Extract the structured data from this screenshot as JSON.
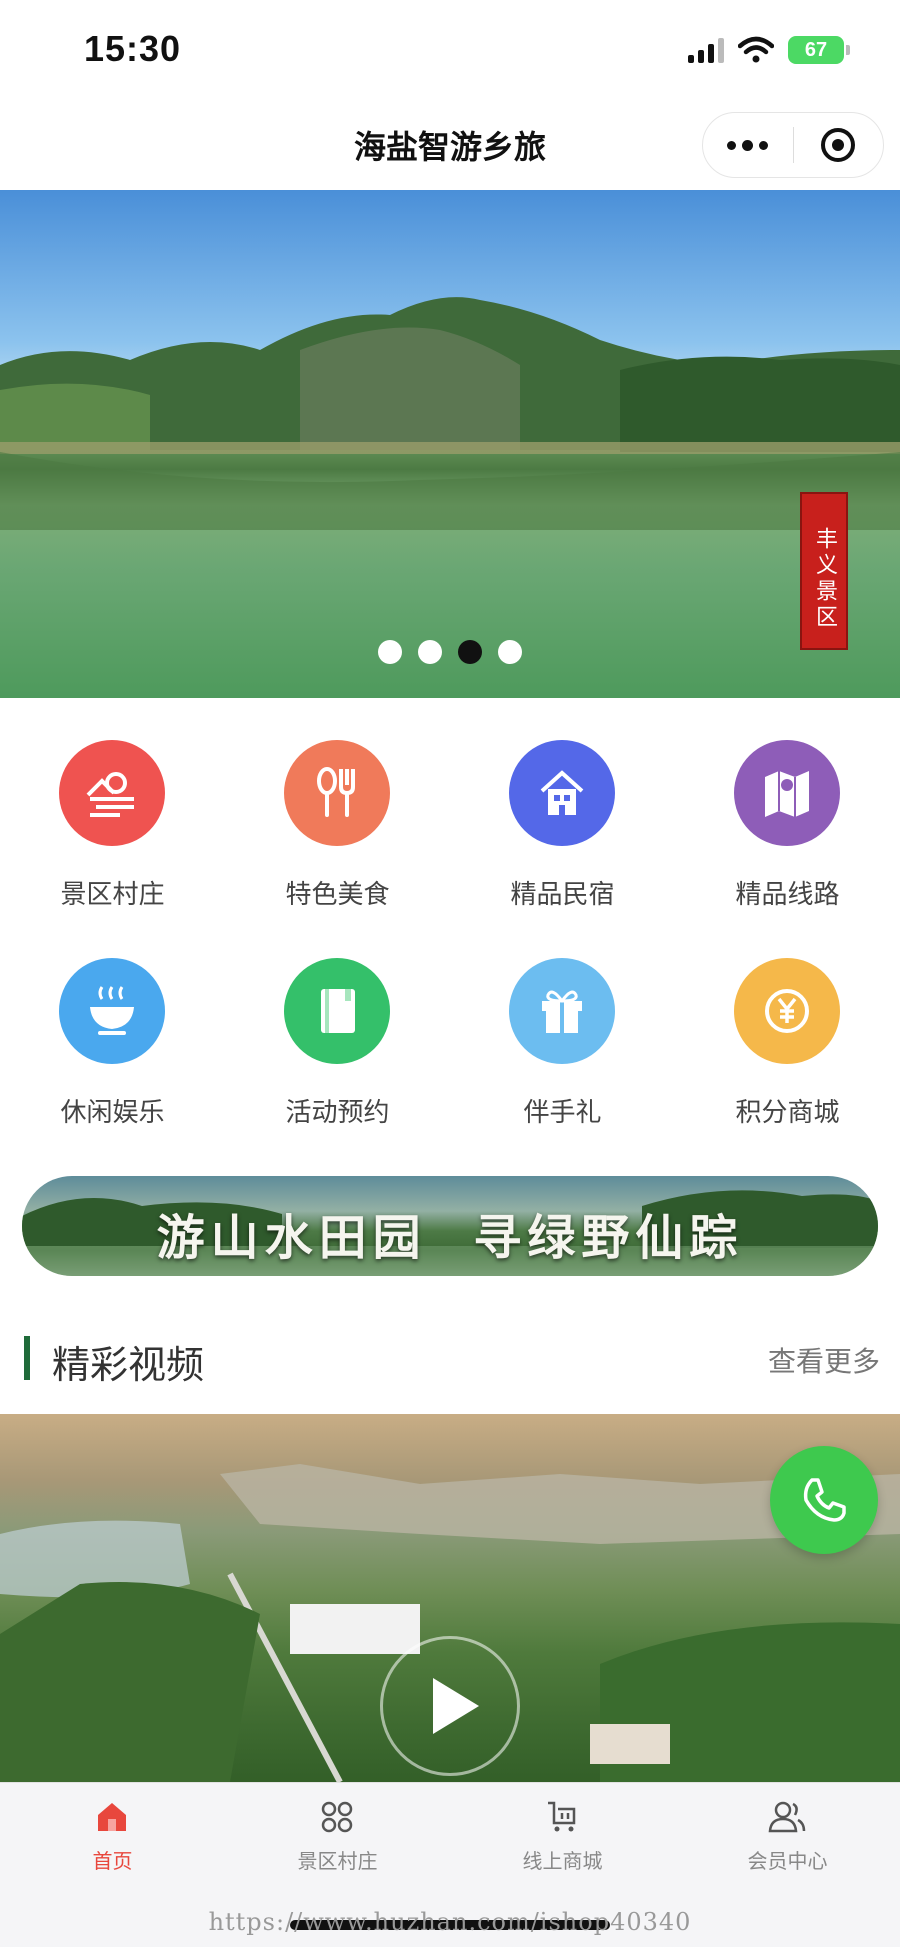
{
  "status": {
    "time": "15:30",
    "battery": "67"
  },
  "nav": {
    "title": "海盐智游乡旅"
  },
  "banner": {
    "seal_text": "丰义景区",
    "slide_count": 4,
    "active_slide": 3
  },
  "categories": [
    {
      "label": "景区村庄",
      "icon": "landscape-icon",
      "color": "#ef5350"
    },
    {
      "label": "特色美食",
      "icon": "utensils-icon",
      "color": "#f07a5a"
    },
    {
      "label": "精品民宿",
      "icon": "homestay-icon",
      "color": "#5468e8"
    },
    {
      "label": "精品线路",
      "icon": "map-icon",
      "color": "#8e5db8"
    },
    {
      "label": "休闲娱乐",
      "icon": "tea-cup-icon",
      "color": "#4aa8ee"
    },
    {
      "label": "活动预约",
      "icon": "book-icon",
      "color": "#34c06a"
    },
    {
      "label": "伴手礼",
      "icon": "gift-icon",
      "color": "#6cbdf0"
    },
    {
      "label": "积分商城",
      "icon": "coin-icon",
      "color": "#f5b84a"
    }
  ],
  "slogan": {
    "text": "游山水田园  寻绿野仙踪"
  },
  "section": {
    "title": "精彩视频",
    "more": "查看更多"
  },
  "tabs": [
    {
      "label": "首页",
      "icon": "home-icon",
      "active": true
    },
    {
      "label": "景区村庄",
      "icon": "grid-icon",
      "active": false
    },
    {
      "label": "线上商城",
      "icon": "cart-icon",
      "active": false
    },
    {
      "label": "会员中心",
      "icon": "members-icon",
      "active": false
    }
  ],
  "watermark": "https://www.huzhan.com/ishop40340",
  "colors": {
    "accent_active": "#e8473d",
    "section_bar": "#1f6b3a",
    "phone_button": "#3ec94e"
  }
}
